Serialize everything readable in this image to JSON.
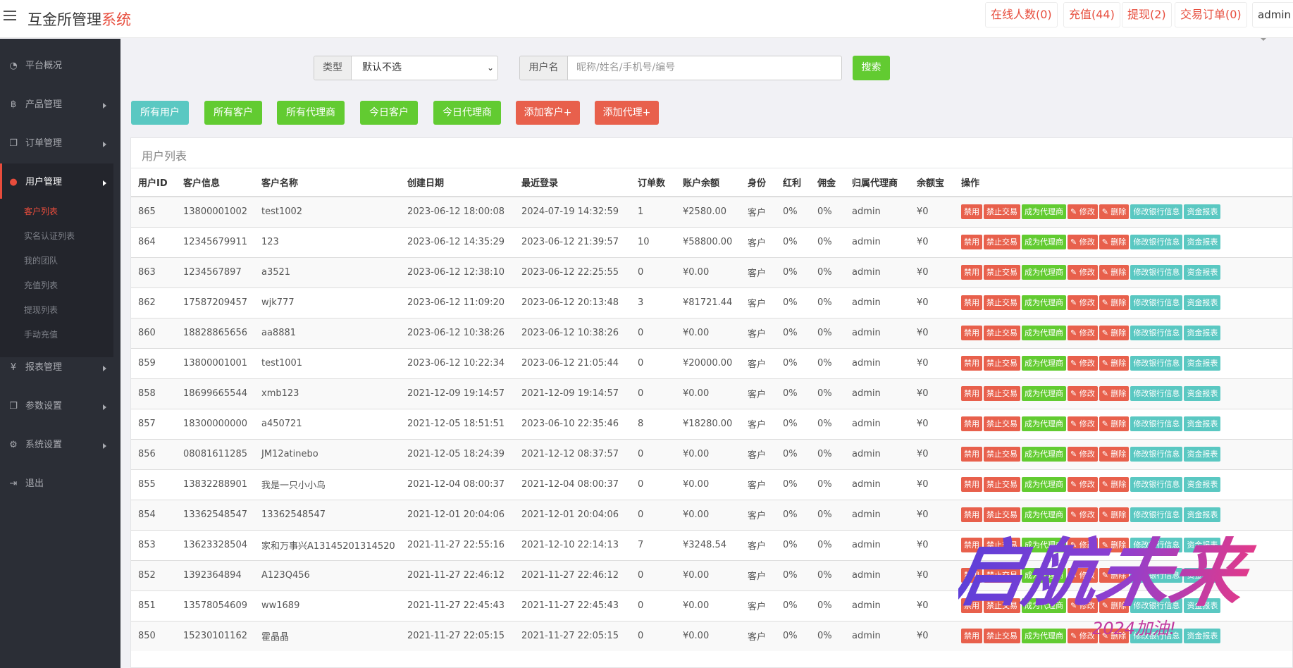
{
  "header": {
    "title_main": "互金所管理",
    "title_accent": "系统",
    "online": "在线人数(0)",
    "recharge": "充值(44)",
    "withdraw": "提现(2)",
    "orders": "交易订单(0)",
    "user": "admin"
  },
  "sidebar": {
    "items": [
      {
        "label": "平台概况",
        "icon": "dashboard-icon"
      },
      {
        "label": "产品管理",
        "icon": "bitcoin-icon"
      },
      {
        "label": "订单管理",
        "icon": "copy-icon"
      },
      {
        "label": "用户管理",
        "icon": "user-icon"
      },
      {
        "label": "报表管理",
        "icon": "yen-icon"
      },
      {
        "label": "参数设置",
        "icon": "copy-icon"
      },
      {
        "label": "系统设置",
        "icon": "gears-icon"
      },
      {
        "label": "退出",
        "icon": "sign-out-icon"
      }
    ],
    "subitems": [
      "客户列表",
      "实名认证列表",
      "我的团队",
      "充值列表",
      "提现列表",
      "手动充值"
    ]
  },
  "search": {
    "type_label": "类型",
    "type_value": "默认不选",
    "name_label": "用户名",
    "name_placeholder": "昵称/姓名/手机号/编号",
    "button": "搜索"
  },
  "filters": [
    "所有用户",
    "所有客户",
    "所有代理商",
    "今日客户",
    "今日代理商",
    "添加客户+",
    "添加代理+"
  ],
  "panel_title": "用户列表",
  "columns": [
    "用户ID",
    "客户信息",
    "客户名称",
    "创建日期",
    "最近登录",
    "订单数",
    "账户余额",
    "身份",
    "红利",
    "佣金",
    "归属代理商",
    "余额宝",
    "操作"
  ],
  "actions": [
    "禁用",
    "禁止交易",
    "成为代理商",
    "✎ 修改",
    "✎ 删除",
    "修改银行信息",
    "资金报表"
  ],
  "rows": [
    [
      "865",
      "13800001002",
      "test1002",
      "2023-06-12 18:00:08",
      "2024-07-19 14:32:59",
      "1",
      "¥2580.00",
      "客户",
      "0%",
      "0%",
      "admin",
      "¥0"
    ],
    [
      "864",
      "12345679911",
      "123",
      "2023-06-12 14:35:29",
      "2023-06-12 21:39:57",
      "10",
      "¥58800.00",
      "客户",
      "0%",
      "0%",
      "admin",
      "¥0"
    ],
    [
      "863",
      "1234567897",
      "a3521",
      "2023-06-12 12:38:10",
      "2023-06-12 22:25:55",
      "0",
      "¥0.00",
      "客户",
      "0%",
      "0%",
      "admin",
      "¥0"
    ],
    [
      "862",
      "17587209457",
      "wjk777",
      "2023-06-12 11:09:20",
      "2023-06-12 20:13:48",
      "3",
      "¥81721.44",
      "客户",
      "0%",
      "0%",
      "admin",
      "¥0"
    ],
    [
      "860",
      "18828865656",
      "aa8881",
      "2023-06-12 10:38:26",
      "2023-06-12 10:38:26",
      "0",
      "¥0.00",
      "客户",
      "0%",
      "0%",
      "admin",
      "¥0"
    ],
    [
      "859",
      "13800001001",
      "test1001",
      "2023-06-12 10:22:34",
      "2023-06-12 21:05:44",
      "0",
      "¥20000.00",
      "客户",
      "0%",
      "0%",
      "admin",
      "¥0"
    ],
    [
      "858",
      "18699665544",
      "xmb123",
      "2021-12-09 19:14:57",
      "2021-12-09 19:14:57",
      "0",
      "¥0.00",
      "客户",
      "0%",
      "0%",
      "admin",
      "¥0"
    ],
    [
      "857",
      "18300000000",
      "a450721",
      "2021-12-05 18:51:51",
      "2023-06-10 22:35:46",
      "8",
      "¥18280.00",
      "客户",
      "0%",
      "0%",
      "admin",
      "¥0"
    ],
    [
      "856",
      "08081611285",
      "JM12atinebo",
      "2021-12-05 18:24:39",
      "2021-12-12 08:37:57",
      "0",
      "¥0.00",
      "客户",
      "0%",
      "0%",
      "admin",
      "¥0"
    ],
    [
      "855",
      "13832288901",
      "我是一只小小鸟",
      "2021-12-04 08:00:37",
      "2021-12-04 08:00:37",
      "0",
      "¥0.00",
      "客户",
      "0%",
      "0%",
      "admin",
      "¥0"
    ],
    [
      "854",
      "13362548547",
      "13362548547",
      "2021-12-01 20:04:06",
      "2021-12-01 20:04:06",
      "0",
      "¥0.00",
      "客户",
      "0%",
      "0%",
      "admin",
      "¥0"
    ],
    [
      "853",
      "13623328504",
      "家和万事兴A13145201314520",
      "2021-11-27 22:55:16",
      "2021-12-10 22:14:13",
      "7",
      "¥3248.54",
      "客户",
      "0%",
      "0%",
      "admin",
      "¥0"
    ],
    [
      "852",
      "1392364894",
      "A123Q456",
      "2021-11-27 22:46:12",
      "2021-11-27 22:46:12",
      "0",
      "¥0.00",
      "客户",
      "0%",
      "0%",
      "admin",
      "¥0"
    ],
    [
      "851",
      "13578054609",
      "ww1689",
      "2021-11-27 22:45:43",
      "2021-11-27 22:45:43",
      "0",
      "¥0.00",
      "客户",
      "0%",
      "0%",
      "admin",
      "¥0"
    ],
    [
      "850",
      "15230101162",
      "霍晶晶",
      "2021-11-27 22:05:15",
      "2021-11-27 22:05:15",
      "0",
      "¥0.00",
      "客户",
      "0%",
      "0%",
      "admin",
      "¥0"
    ]
  ],
  "watermark": {
    "text1": "启航未来",
    "text2": "2024加油!"
  },
  "colors": {
    "accent": "#e74c3c",
    "green": "#62cb31",
    "teal": "#5ac8c2",
    "sidebar": "#2b2e36"
  }
}
